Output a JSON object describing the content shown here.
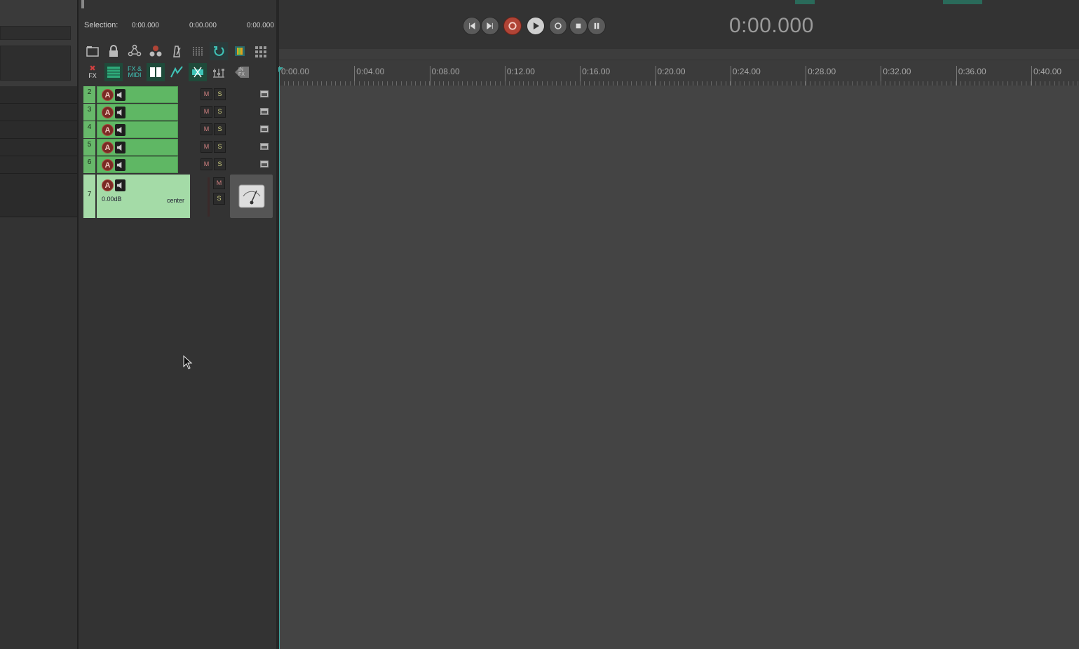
{
  "selection": {
    "label": "Selection:",
    "start": "0:00.000",
    "end": "0:00.000",
    "length": "0:00.000"
  },
  "toolbar": {
    "row1": [
      "folder-icon",
      "lock-icon",
      "grouping-icon",
      "routing-icon",
      "metronome-icon",
      "grid-icon",
      "loop-icon",
      "color-icon",
      "matrix-icon"
    ],
    "row2": [
      "fx-bypass-icon",
      "track-list-icon",
      "fx-midi-icon",
      "split-view-icon",
      "envelope-icon",
      "ripple-edit-icon",
      "mixer-icon",
      "in-fx-icon"
    ],
    "fx_label": "FX",
    "fx_midi_label": "FX & MIDI",
    "in_fx_label": "IN FX"
  },
  "tracks": [
    {
      "number": "2",
      "arm": "A",
      "mute": "M",
      "solo": "S"
    },
    {
      "number": "3",
      "arm": "A",
      "mute": "M",
      "solo": "S"
    },
    {
      "number": "4",
      "arm": "A",
      "mute": "M",
      "solo": "S"
    },
    {
      "number": "5",
      "arm": "A",
      "mute": "M",
      "solo": "S"
    },
    {
      "number": "6",
      "arm": "A",
      "mute": "M",
      "solo": "S"
    }
  ],
  "track7": {
    "number": "7",
    "arm": "A",
    "volume": "0.00dB",
    "pan": "center",
    "mute": "M",
    "solo": "S"
  },
  "transport": {
    "time": "0:00.000"
  },
  "ruler": {
    "labels": [
      "0:00.00",
      "0:04.00",
      "0:08.00",
      "0:12.00",
      "0:16.00",
      "0:20.00",
      "0:24.00",
      "0:28.00",
      "0:32.00",
      "0:36.00",
      "0:40.00"
    ]
  },
  "colors": {
    "track_green": "#5fb764",
    "selected_track": "#a4dba7",
    "record": "#b04436",
    "cursor": "#3fa7a0"
  }
}
